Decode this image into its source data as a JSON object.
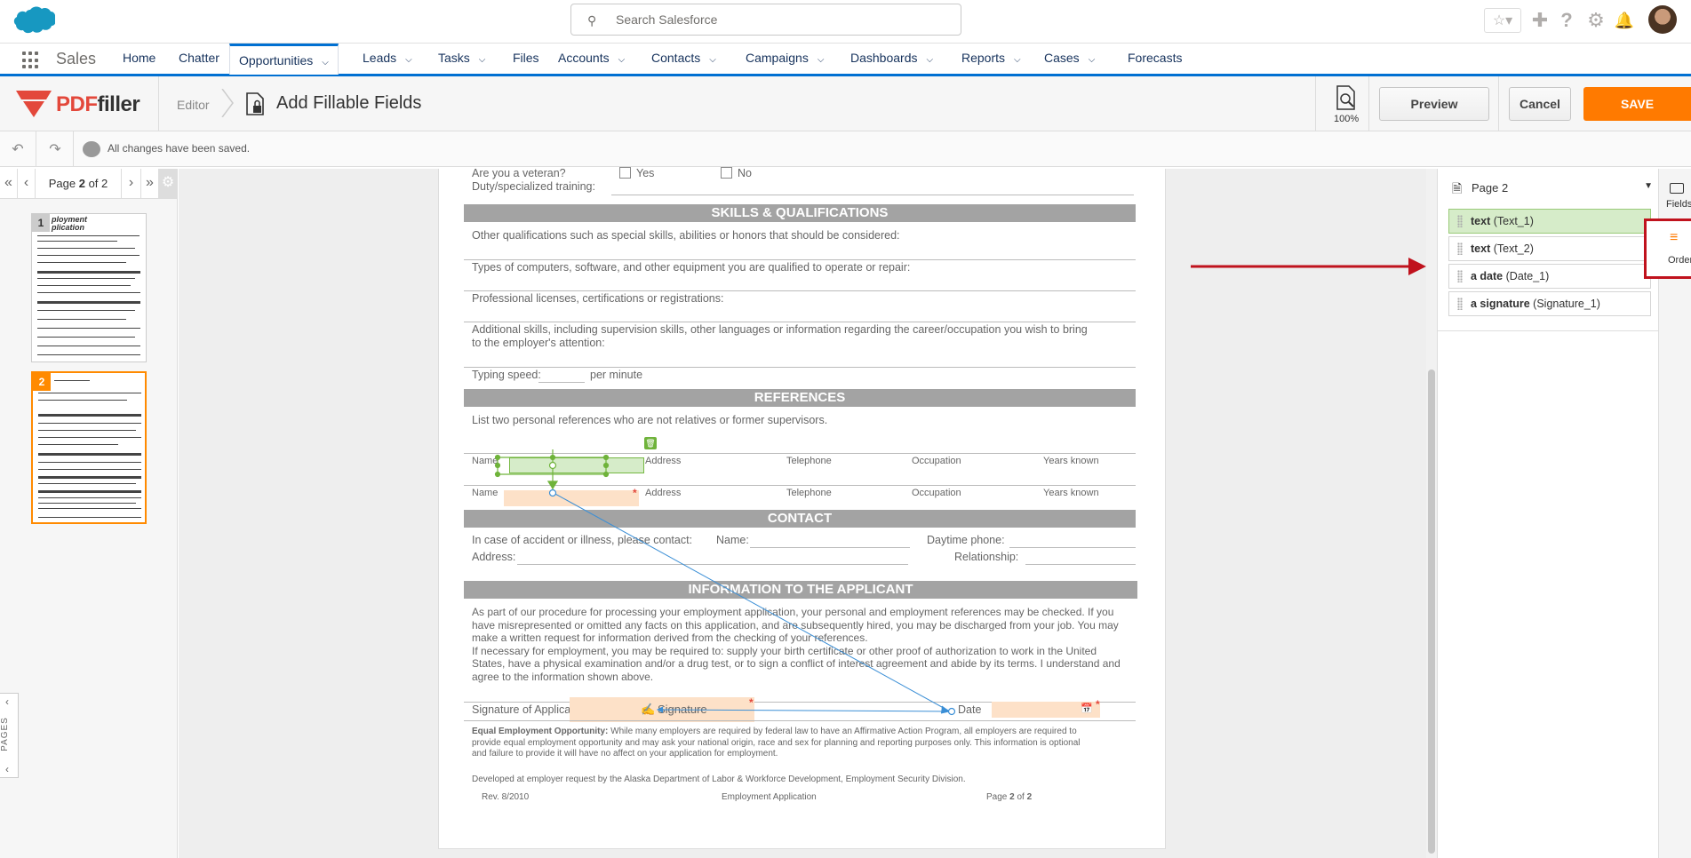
{
  "header": {
    "search_placeholder": "Search Salesforce"
  },
  "nav": {
    "app_name": "Sales",
    "items": [
      {
        "label": "Home",
        "chevron": false
      },
      {
        "label": "Chatter",
        "chevron": false
      },
      {
        "label": "Opportunities",
        "chevron": true,
        "active": true
      },
      {
        "label": "Leads",
        "chevron": true
      },
      {
        "label": "Tasks",
        "chevron": true
      },
      {
        "label": "Files",
        "chevron": false
      },
      {
        "label": "Accounts",
        "chevron": true
      },
      {
        "label": "Contacts",
        "chevron": true
      },
      {
        "label": "Campaigns",
        "chevron": true
      },
      {
        "label": "Dashboards",
        "chevron": true
      },
      {
        "label": "Reports",
        "chevron": true
      },
      {
        "label": "Cases",
        "chevron": true
      },
      {
        "label": "Forecasts",
        "chevron": false
      }
    ]
  },
  "pdffiller": {
    "logo_pdf": "PDF",
    "logo_filler": "filler",
    "crumb_editor": "Editor",
    "title": "Add Fillable Fields",
    "zoom": "100%",
    "preview_label": "Preview",
    "cancel_label": "Cancel",
    "save_label": "SAVE",
    "accent": "#ff7a00"
  },
  "toolbar": {
    "status": "All changes have been saved."
  },
  "pager": {
    "page_label": "Page",
    "current": "2",
    "of_label": "of 2",
    "pages_tab": "PAGES"
  },
  "thumbs": [
    {
      "num": "1",
      "title_a": "ployment",
      "title_b": "plication"
    },
    {
      "num": "2"
    }
  ],
  "document": {
    "veteran_q": "Are you a veteran?",
    "yes": "Yes",
    "no": "No",
    "duty": "Duty/specialized training:",
    "sec_skills": "SKILLS & QUALIFICATIONS",
    "q_other": "Other qualifications such as special skills, abilities or honors that should be considered:",
    "q_computers": "Types of computers, software, and other equipment you are qualified to operate or repair:",
    "q_licenses": "Professional licenses, certifications or registrations:",
    "q_additional_1": "Additional skills, including supervision skills, other languages or information regarding the career/occupation you wish to bring",
    "q_additional_2": "to the employer's attention:",
    "typing_speed": "Typing speed:",
    "per_minute": "per  minute",
    "sec_refs": "REFERENCES",
    "refs_intro": "List two personal references who are not relatives or former supervisors.",
    "col_name": "Name",
    "col_address": "Address",
    "col_telephone": "Telephone",
    "col_occupation": "Occupation",
    "col_years": "Years known",
    "sec_contact": "CONTACT",
    "contact_q": "In case of accident or illness, please contact:",
    "contact_name": "Name:",
    "daytime_phone": "Daytime phone:",
    "address": "Address:",
    "relationship": "Relationship:",
    "sec_info": "INFORMATION TO THE APPLICANT",
    "info_p1_1": "As part of our procedure for processing your employment application, your personal and employment references may be checked. If you",
    "info_p1_2": "have misrepresented or omitted any facts on this application, and are subsequently hired, you may be discharged from your job. You may",
    "info_p1_3": "make a written request for information derived from the checking of your references.",
    "info_p2_1": "If necessary for employment, you may be required to: supply your birth certificate or other proof of authorization to work in the United",
    "info_p2_2": "States, have a physical examination and/or a drug test, or to sign a conflict of interest agreement and abide by its terms. I understand and",
    "info_p2_3": "agree to the information shown above.",
    "sig_label": "Signature of Applicant",
    "sig_field": "Signature",
    "date_label": "Date",
    "eeo_head": "Equal Employment Opportunity:",
    "eeo_1": "While many employers are required by federal law to have an Affirmative Action Program, all employers are required to",
    "eeo_2": "provide equal employment opportunity and may ask your national origin, race and sex for planning and reporting purposes only. This information is optional",
    "eeo_3": "and failure to provide it will have no affect on your application for employment.",
    "developed": "Developed at employer request by the Alaska Department of Labor & Workforce Development, Employment Security Division.",
    "rev": "Rev. 8/2010",
    "footer_title": "Employment Application",
    "footer_page": "Page",
    "footer_page_num": "2",
    "footer_of": "of",
    "footer_total": "2"
  },
  "right_panel": {
    "page_select": "Page 2",
    "fields": [
      {
        "type": "text",
        "name": "(Text_1)",
        "active": true
      },
      {
        "type": "text",
        "name": "(Text_2)",
        "active": false
      },
      {
        "type": "a date",
        "name": "(Date_1)",
        "active": false
      },
      {
        "type": "a signature",
        "name": "(Signature_1)",
        "active": false
      }
    ],
    "tab_fields": "Fields",
    "tab_order": "Order"
  }
}
